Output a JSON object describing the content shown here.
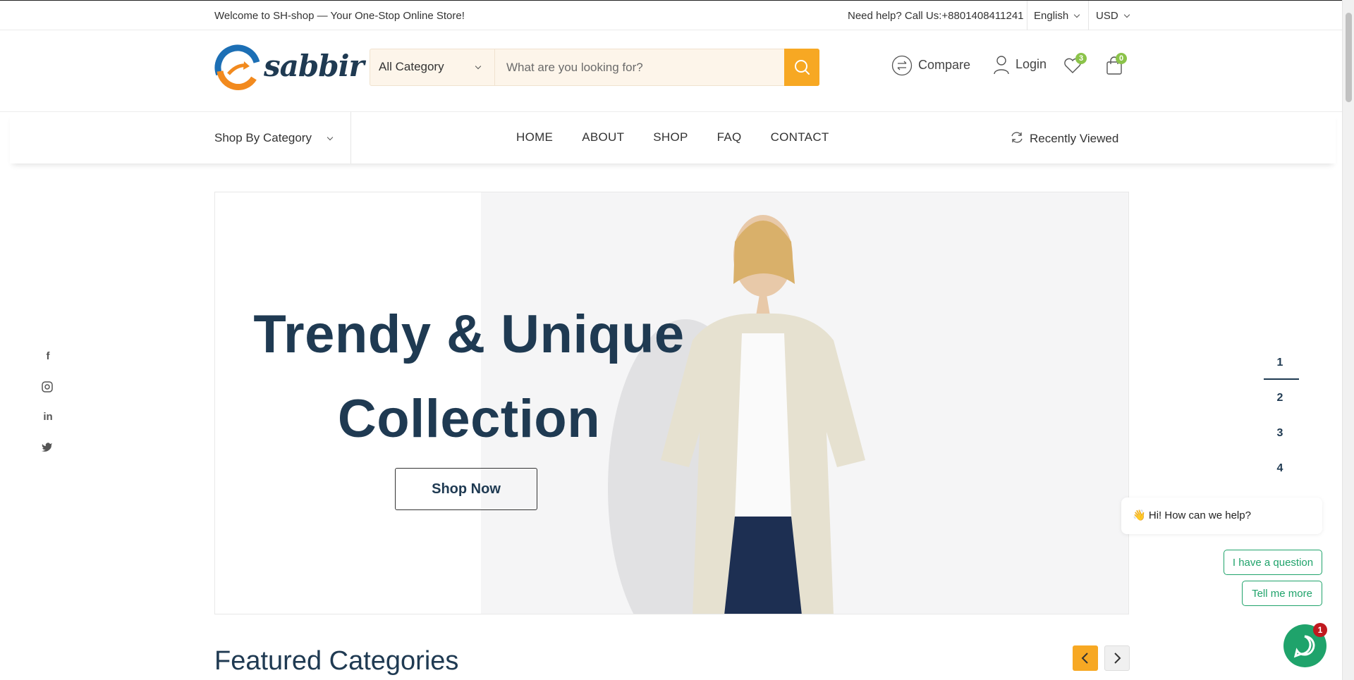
{
  "topbar": {
    "welcome": "Welcome to SH-shop — Your One-Stop Online Store!",
    "help": "Need help? Call Us:+8801408411241",
    "language": "English",
    "currency": "USD"
  },
  "header": {
    "logo_text": "sabbir",
    "category_select": "All Category",
    "search_placeholder": "What are you looking for?",
    "compare_label": "Compare",
    "login_label": "Login",
    "wishlist_count": "3",
    "cart_count": "0"
  },
  "nav": {
    "shop_by_category": "Shop By Category",
    "menu": [
      "HOME",
      "ABOUT",
      "SHOP",
      "FAQ",
      "CONTACT"
    ],
    "recently_viewed": "Recently Viewed"
  },
  "hero": {
    "title_line1": "Trendy & Unique",
    "title_line2": "Collection",
    "button": "Shop Now"
  },
  "social": [
    "f",
    "instagram",
    "in",
    "twitter"
  ],
  "pager": [
    "1",
    "2",
    "3",
    "4"
  ],
  "chat": {
    "greeting": "Hi! How can we help?",
    "option1": "I have a question",
    "option2": "Tell me more",
    "badge": "1"
  },
  "featured": {
    "title": "Featured Categories"
  },
  "colors": {
    "accent": "#f7a823",
    "primary": "#1f3a52",
    "badge": "#8bc34a",
    "chat": "#1fa36b"
  }
}
